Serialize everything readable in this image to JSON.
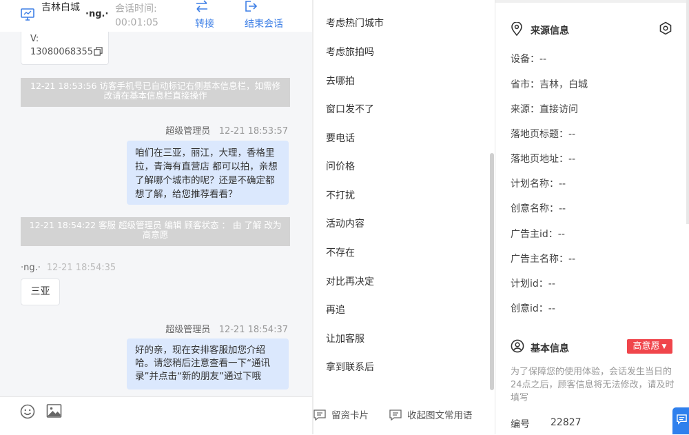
{
  "header": {
    "location": "吉林白城",
    "visitor_nick": "·ng.·",
    "session_time_label": "会话时间:",
    "session_time": "00:01:05",
    "transfer_label": "转接",
    "end_session_label": "结束会话"
  },
  "chat": {
    "phone_card": {
      "line1": "V:",
      "line2": "13080068355"
    },
    "messages": [
      {
        "type": "system",
        "text": "12-21 18:53:56 访客手机号已自动标记右侧基本信息栏，如需修改请在基本信息栏直接操作"
      },
      {
        "type": "agent",
        "sender": "超级管理员",
        "time": "12-21 18:53:57",
        "text": "咱们在三亚，丽江，大理，香格里拉，青海有直营店 都可以拍，亲想了解哪个城市的呢？还是不确定都想了解，给您推荐看看？"
      },
      {
        "type": "system",
        "text": "12-21 18:54:22 客服 超级管理员 编辑 顾客状态 ： 由 了解 改为 高意愿"
      },
      {
        "type": "visitor",
        "sender": "·ng.·",
        "time": "12-21 18:54:35",
        "text": "三亚"
      },
      {
        "type": "agent",
        "sender": "超级管理员",
        "time": "12-21 18:54:37",
        "text": "好的亲，现在安排客服加您介绍哈。请您稍后注意查看一下“通讯录”并点击“新的朋友”通过下哦"
      }
    ]
  },
  "quick_replies": [
    "考虑热门城市",
    "考虑旅拍吗",
    "去哪拍",
    "窗口发不了",
    "要电话",
    "问价格",
    "不打扰",
    "活动内容",
    "不存在",
    "对比再决定",
    "再追",
    "让加客服",
    "拿到联系后"
  ],
  "footer": {
    "card_label": "留资卡片",
    "collapse_label": "收起图文常用语"
  },
  "source_info": {
    "title": "来源信息",
    "fields": [
      "设备：--",
      "省市：吉林，白城",
      "来源：直接访问",
      "落地页标题：--",
      "落地页地址：--",
      "计划名称：--",
      "创意名称：--",
      "广告主id：--",
      "广告主名称：--",
      "计划id：--",
      "创意id：--"
    ]
  },
  "basic_info": {
    "title": "基本信息",
    "intent_tag": "高意愿",
    "note": "为了保障您的使用体验，会话发生当日的24点之后，顾客信息将无法修改，请及时填写",
    "id_label": "编号",
    "id_value": "22827"
  },
  "colors": {
    "accent": "#3d7fe6",
    "agent_bubble": "#dbe8fd",
    "system_notice": "#d3d3d3",
    "intent_tag": "#f0454b"
  }
}
